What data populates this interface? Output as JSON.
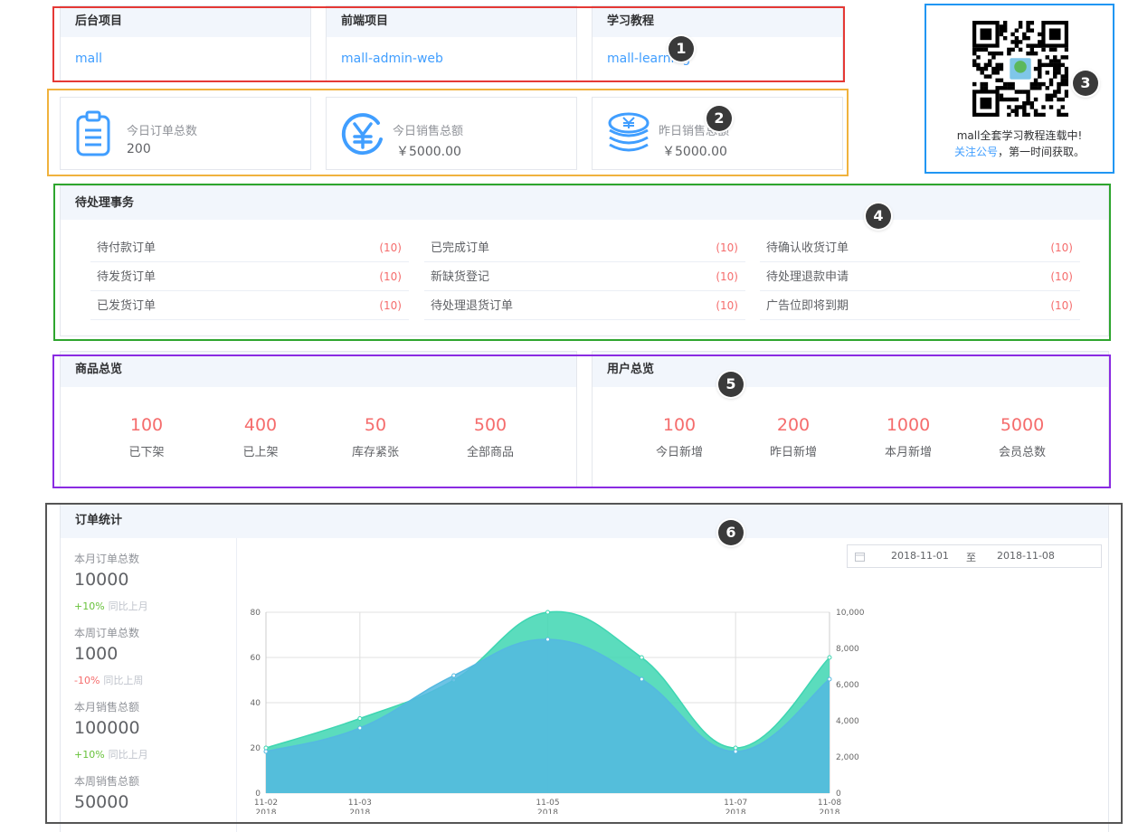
{
  "projects": [
    {
      "title": "后台项目",
      "link": "mall"
    },
    {
      "title": "前端项目",
      "link": "mall-admin-web"
    },
    {
      "title": "学习教程",
      "link": "mall-learning"
    }
  ],
  "stats": [
    {
      "icon": "clipboard-icon",
      "label": "今日订单总数",
      "value": "200"
    },
    {
      "icon": "yen-circle-icon",
      "label": "今日销售总额",
      "value": "￥5000.00"
    },
    {
      "icon": "coin-stack-icon",
      "label": "昨日销售总额",
      "value": "￥5000.00"
    }
  ],
  "qr": {
    "line1": "mall全套学习教程连载中!",
    "link": "关注公号",
    "line2": "，第一时间获取。"
  },
  "todo": {
    "title": "待处理事务",
    "columns": [
      [
        {
          "label": "待付款订单",
          "count": "(10)"
        },
        {
          "label": "待发货订单",
          "count": "(10)"
        },
        {
          "label": "已发货订单",
          "count": "(10)"
        }
      ],
      [
        {
          "label": "已完成订单",
          "count": "(10)"
        },
        {
          "label": "新缺货登记",
          "count": "(10)"
        },
        {
          "label": "待处理退货订单",
          "count": "(10)"
        }
      ],
      [
        {
          "label": "待确认收货订单",
          "count": "(10)"
        },
        {
          "label": "待处理退款申请",
          "count": "(10)"
        },
        {
          "label": "广告位即将到期",
          "count": "(10)"
        }
      ]
    ]
  },
  "goods": {
    "title": "商品总览",
    "items": [
      {
        "value": "100",
        "label": "已下架"
      },
      {
        "value": "400",
        "label": "已上架"
      },
      {
        "value": "50",
        "label": "库存紧张"
      },
      {
        "value": "500",
        "label": "全部商品"
      }
    ]
  },
  "users": {
    "title": "用户总览",
    "items": [
      {
        "value": "100",
        "label": "今日新增"
      },
      {
        "value": "200",
        "label": "昨日新增"
      },
      {
        "value": "1000",
        "label": "本月新增"
      },
      {
        "value": "5000",
        "label": "会员总数"
      }
    ]
  },
  "orders": {
    "title": "订单统计",
    "metrics": [
      {
        "label": "本月订单总数",
        "value": "10000",
        "change": "+10%",
        "cmp": "同比上月",
        "dir": "up"
      },
      {
        "label": "本周订单总数",
        "value": "1000",
        "change": "-10%",
        "cmp": "同比上周",
        "dir": "down"
      },
      {
        "label": "本月销售总额",
        "value": "100000",
        "change": "+10%",
        "cmp": "同比上月",
        "dir": "up"
      },
      {
        "label": "本周销售总额",
        "value": "50000"
      }
    ],
    "date_start": "2018-11-01",
    "date_sep": "至",
    "date_end": "2018-11-08"
  },
  "badges": [
    "1",
    "2",
    "3",
    "4",
    "5",
    "6"
  ],
  "chart_data": {
    "type": "area",
    "x": [
      "2018-11-02",
      "2018-11-03",
      "2018-11-04",
      "2018-11-05",
      "2018-11-06",
      "2018-11-07",
      "2018-11-08"
    ],
    "x_tick_labels": [
      "11-02",
      "11-03",
      "11-05",
      "11-07",
      "11-08"
    ],
    "series": [
      {
        "values": [
          20,
          33,
          50,
          80,
          60,
          20,
          60
        ],
        "axis": "left",
        "color": "#3ed6b2"
      },
      {
        "values": [
          2300,
          3600,
          6500,
          8500,
          6300,
          2300,
          6300
        ],
        "axis": "right",
        "color": "#54b9e0"
      }
    ],
    "ylim_left": [
      0,
      80
    ],
    "yticks_left": [
      "0",
      "20",
      "40",
      "60",
      "80"
    ],
    "ylim_right": [
      0,
      10000
    ],
    "yticks_right": [
      "0",
      "2,000",
      "4,000",
      "6,000",
      "8,000",
      "10,000"
    ],
    "grid": true
  }
}
